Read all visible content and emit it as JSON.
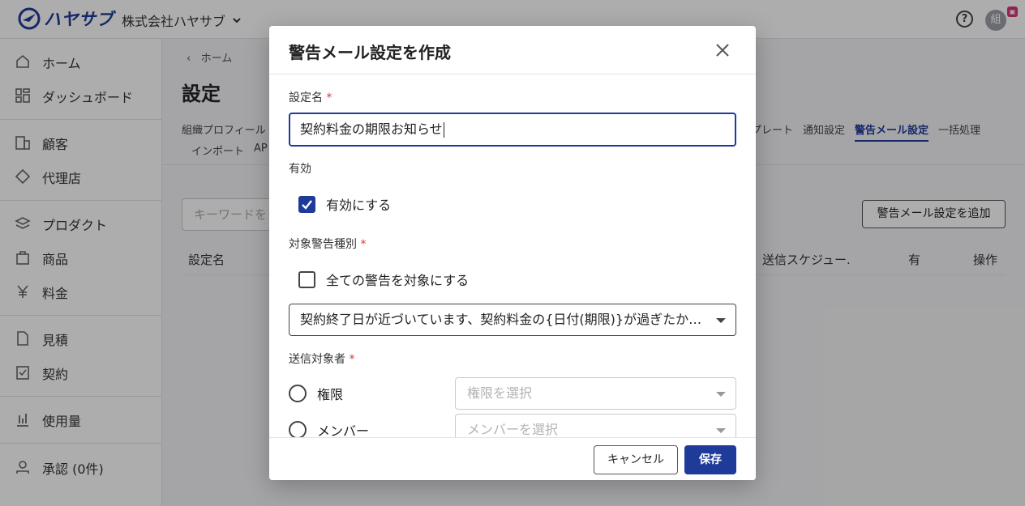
{
  "app": {
    "logo_text": "ハヤサブ",
    "org_name": "株式会社ハヤサブ",
    "help_glyph": "?",
    "avatar_initial": "組"
  },
  "sidebar": {
    "items": [
      {
        "label": "ホーム",
        "icon": "home-icon"
      },
      {
        "label": "ダッシュボード",
        "icon": "dashboard-icon"
      },
      {
        "label": "顧客",
        "icon": "customer-icon"
      },
      {
        "label": "代理店",
        "icon": "agency-icon"
      },
      {
        "label": "プロダクト",
        "icon": "product-icon"
      },
      {
        "label": "商品",
        "icon": "item-icon"
      },
      {
        "label": "料金",
        "icon": "yen-icon"
      },
      {
        "label": "見積",
        "icon": "quote-icon"
      },
      {
        "label": "契約",
        "icon": "contract-icon"
      },
      {
        "label": "使用量",
        "icon": "usage-icon"
      },
      {
        "label": "承認 (0件)",
        "icon": "approval-icon"
      }
    ]
  },
  "main": {
    "breadcrumb": "ホーム",
    "page_title": "設定",
    "tabs_left": "組織プロフィール",
    "tabs_right": [
      "プレート",
      "通知設定",
      "警告メール設定",
      "一括処理"
    ],
    "tabs_row2": [
      "インポート",
      "AP"
    ],
    "search_placeholder": "キーワードを",
    "add_button": "警告メール設定を追加",
    "table_headers": [
      "設定名",
      "送信スケジュー.",
      "有",
      "操作"
    ]
  },
  "modal": {
    "title": "警告メール設定を作成",
    "name_label": "設定名",
    "required_mark": "*",
    "name_value": "契約料金の期限お知らせ",
    "enabled_label": "有効",
    "enabled_checkbox_label": "有効にする",
    "warning_type_label": "対象警告種別",
    "all_warnings_label": "全ての警告を対象にする",
    "warning_type_value": "契約終了日が近づいています、契約料金の{日付(期限)}が過ぎたか近づいています",
    "recipient_label": "送信対象者",
    "radio_role": "権限",
    "role_placeholder": "権限を選択",
    "radio_member": "メンバー",
    "member_placeholder": "メンバーを選択",
    "cancel_button": "キャンセル",
    "save_button": "保存"
  }
}
